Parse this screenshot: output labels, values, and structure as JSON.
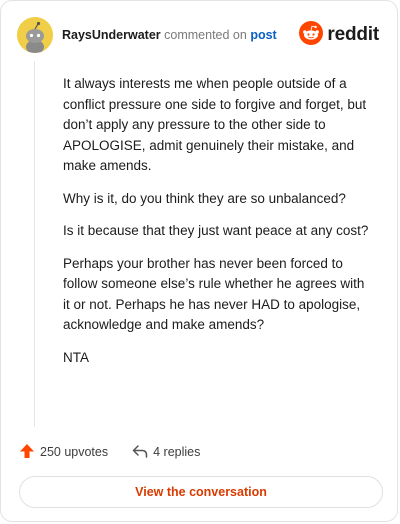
{
  "header": {
    "author": "RaysUnderwater",
    "commented_on": "commented on",
    "post_link": "post",
    "brand_name": "reddit",
    "avatar_icon": "snoo-avatar-icon",
    "brand_icon": "reddit-logo-icon"
  },
  "comment": {
    "paragraphs": [
      "It always interests me when people outside of a conflict pressure one side to forgive and forget, but don’t apply any pressure to the other side to APOLOGISE, admit genuinely their mistake, and make amends.",
      "Why is it, do you think they are so unbalanced?",
      "Is it because that they just want peace at any cost?",
      "Perhaps your brother has never been forced to follow someone else’s rule whether he agrees with it or not. Perhaps he has never HAD to apologise, acknowledge and make amends?",
      "NTA"
    ]
  },
  "footer": {
    "upvotes": "250 upvotes",
    "replies": "4 replies",
    "upvote_icon": "upvote-arrow-icon",
    "reply_icon": "reply-icon"
  },
  "cta": {
    "label": "View the conversation"
  },
  "colors": {
    "accent": "#d93a00",
    "reddit_orange": "#ff4500",
    "link_blue": "#0b5fc4",
    "avatar_yellow": "#f0ce47"
  }
}
